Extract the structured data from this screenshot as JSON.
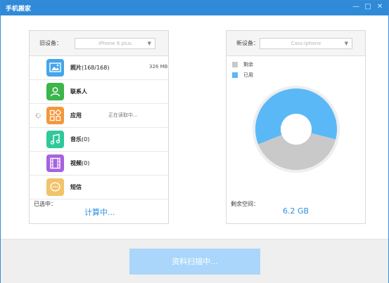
{
  "window": {
    "title": "手机搬家"
  },
  "left_panel": {
    "device_label": "旧设备：",
    "device_value": "iPhone 6 plus",
    "items": [
      {
        "name": "照片",
        "count": "(168/168)",
        "size": "326 MB",
        "icon": "photo-icon",
        "color": "#43a6ea",
        "status": ""
      },
      {
        "name": "联系人",
        "count": "",
        "size": "",
        "icon": "contacts-icon",
        "color": "#3cb54a",
        "status": ""
      },
      {
        "name": "应用",
        "count": "",
        "size": "",
        "icon": "apps-icon",
        "color": "#f5973a",
        "status": "正在读取中..."
      },
      {
        "name": "音乐",
        "count": "(0)",
        "size": "",
        "icon": "music-icon",
        "color": "#2fc99b",
        "status": ""
      },
      {
        "name": "视频",
        "count": "(0)",
        "size": "",
        "icon": "video-icon",
        "color": "#a762e0",
        "status": ""
      },
      {
        "name": "短信",
        "count": "",
        "size": "",
        "icon": "message-icon",
        "color": "#f2c36a",
        "status": ""
      }
    ],
    "selected_label": "已选中：",
    "selected_value": "计算中..."
  },
  "right_panel": {
    "device_label": "新设备：",
    "device_value": "Cass-iphone",
    "legend": [
      {
        "label": "剩余",
        "color": "#c9c9c9"
      },
      {
        "label": "已用",
        "color": "#5ab8f7"
      }
    ],
    "chart_data": {
      "type": "pie",
      "categories": [
        "剩余",
        "已用"
      ],
      "values": [
        40,
        60
      ]
    },
    "free_label": "剩余空间：",
    "free_value": "6.2 GB"
  },
  "scan_button": {
    "label": "资料扫描中..."
  }
}
